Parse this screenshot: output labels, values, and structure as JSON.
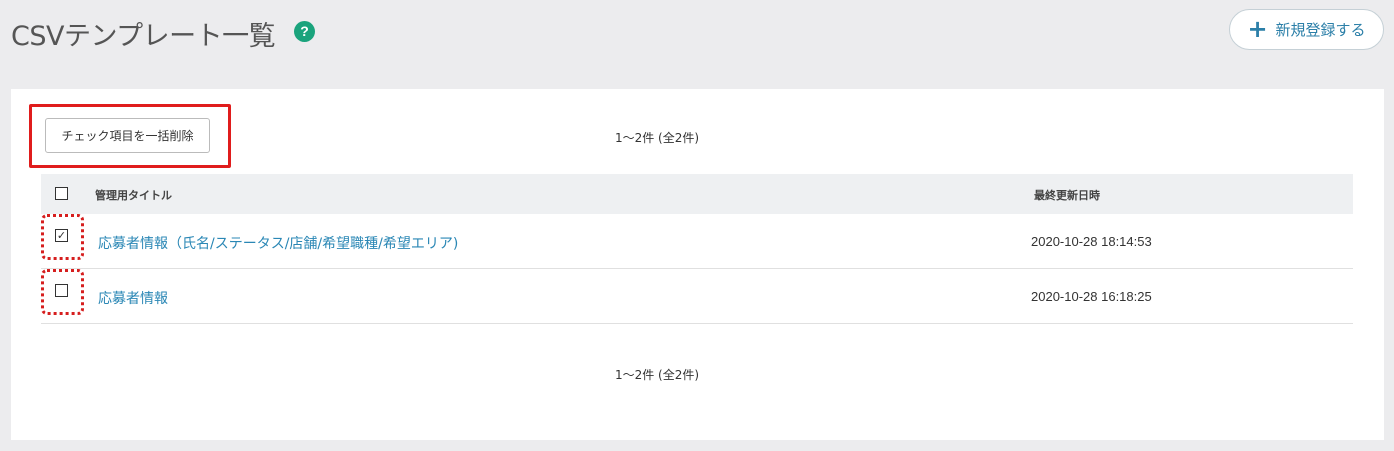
{
  "header": {
    "title": "CSVテンプレート一覧",
    "help_icon": "question-circle-icon",
    "help_glyph": "?",
    "new_button_label": "新規登録する",
    "new_button_icon": "plus-icon"
  },
  "toolbar": {
    "bulk_delete_label": "チェック項目を一括削除"
  },
  "pagination": {
    "top": "1〜2件 (全2件)",
    "bottom": "1〜2件 (全2件)"
  },
  "table": {
    "columns": [
      "管理用タイトル",
      "最終更新日時"
    ],
    "rows": [
      {
        "checked": true,
        "title": "応募者情報（氏名/ステータス/店舗/希望職種/希望エリア)",
        "updated": "2020-10-28 18:14:53"
      },
      {
        "checked": false,
        "title": "応募者情報",
        "updated": "2020-10-28 16:18:25"
      }
    ]
  },
  "colors": {
    "accent": "#2a87b5",
    "help": "#1aa37c",
    "highlight": "#e01c1c"
  }
}
